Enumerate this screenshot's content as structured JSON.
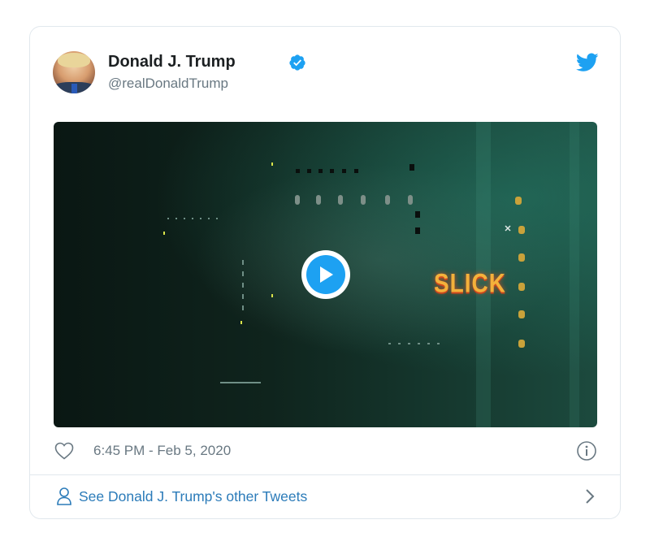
{
  "tweet": {
    "author_name": "Donald J. Trump",
    "author_handle": "@realDonaldTrump",
    "verified": true,
    "icons": {
      "avatar": "user-avatar",
      "verified": "verified-badge-icon",
      "brand": "twitter-bird-icon"
    },
    "media": {
      "overlay_text": "SLICK",
      "play_icon": "play-icon"
    },
    "timestamp": "6:45 PM - Feb 5, 2020",
    "like_icon": "heart-icon",
    "info_icon": "info-icon",
    "footer": {
      "link_text": "See Donald J. Trump's other Tweets",
      "person_icon": "person-icon",
      "chevron_icon": "chevron-right-icon"
    }
  },
  "colors": {
    "brand_blue": "#1da1f2",
    "link_blue": "#2b7bb9",
    "muted_text": "#697882",
    "primary_text": "#1c2022",
    "border": "#e1e8ed"
  }
}
